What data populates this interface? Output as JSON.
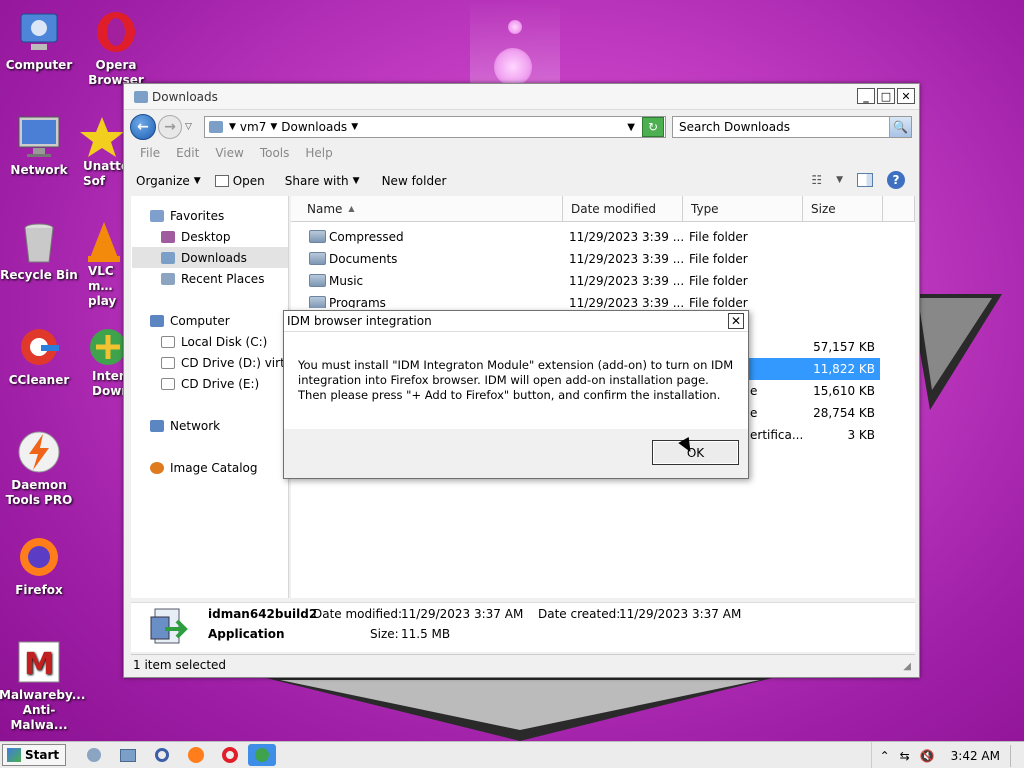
{
  "desktop": {
    "icons": [
      {
        "label": "Computer",
        "icon": "computer-icon"
      },
      {
        "label": "Opera Browser",
        "icon": "opera-icon"
      },
      {
        "label": "Network",
        "icon": "network-icon"
      },
      {
        "label": "Unatte… Sof",
        "icon": "star-icon"
      },
      {
        "label": "Recycle Bin",
        "icon": "recycle-bin-icon"
      },
      {
        "label": "VLC m… play",
        "icon": "vlc-icon"
      },
      {
        "label": "CCleaner",
        "icon": "ccleaner-icon"
      },
      {
        "label": "Inter… Down",
        "icon": "idm-icon"
      },
      {
        "label": "Daemon Tools PRO",
        "icon": "daemon-tools-icon"
      },
      {
        "label": "Firefox",
        "icon": "firefox-icon"
      },
      {
        "label": "Malwareby... Anti-Malwa...",
        "icon": "malwarebytes-icon"
      }
    ]
  },
  "explorer": {
    "title": "Downloads",
    "address": {
      "segments": [
        "vm7",
        "Downloads"
      ]
    },
    "search_placeholder": "Search Downloads",
    "menu": [
      "File",
      "Edit",
      "View",
      "Tools",
      "Help"
    ],
    "toolbar": {
      "organize": "Organize",
      "open": "Open",
      "share_with": "Share with",
      "new_folder": "New folder"
    },
    "nav": {
      "favorites": "Favorites",
      "desktop": "Desktop",
      "downloads": "Downloads",
      "recent_places": "Recent Places",
      "computer": "Computer",
      "local_disk": "Local Disk (C:)",
      "cd_drive_d": "CD Drive (D:) virti",
      "cd_drive_e": "CD Drive (E:)",
      "network": "Network",
      "image_catalog": "Image Catalog"
    },
    "columns": {
      "name": "Name",
      "date": "Date modified",
      "type": "Type",
      "size": "Size"
    },
    "files": [
      {
        "name": "Compressed",
        "date": "11/29/2023 3:39 ...",
        "type": "File folder",
        "size": ""
      },
      {
        "name": "Documents",
        "date": "11/29/2023 3:39 ...",
        "type": "File folder",
        "size": ""
      },
      {
        "name": "Music",
        "date": "11/29/2023 3:39 ...",
        "type": "File folder",
        "size": ""
      },
      {
        "name": "Programs",
        "date": "11/29/2023 3:39 ...",
        "type": "File folder",
        "size": ""
      }
    ],
    "partial_rows": [
      {
        "type": "",
        "size": "57,157 KB"
      },
      {
        "type": "",
        "size": "11,822 KB"
      },
      {
        "type": "e",
        "size": "15,610 KB"
      },
      {
        "type": "e",
        "size": "28,754 KB"
      },
      {
        "type": "ertifica...",
        "size": "3 KB"
      }
    ],
    "details": {
      "name": "idman642build2",
      "kind": "Application",
      "date_modified_label": "Date modified:",
      "date_modified": "11/29/2023 3:37 AM",
      "date_created_label": "Date created:",
      "date_created": "11/29/2023 3:37 AM",
      "size_label": "Size:",
      "size": "11.5 MB"
    },
    "status": "1 item selected"
  },
  "dialog": {
    "title": "IDM browser integration",
    "message": "You must install \"IDM Integraton Module\" extension (add-on) to turn on IDM integration into Firefox browser. IDM will open add-on installation page. Then please press \"+ Add to Firefox\" button, and confirm the installation.",
    "ok": "OK"
  },
  "taskbar": {
    "start": "Start",
    "clock": "3:42 AM"
  }
}
